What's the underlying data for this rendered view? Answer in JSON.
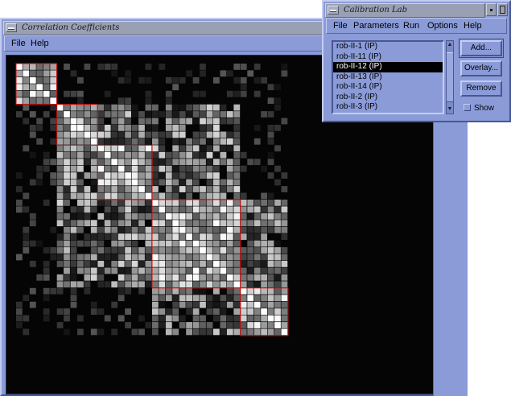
{
  "correlation_window": {
    "title": "Correlation Coefficients",
    "menu": [
      "File",
      "Help"
    ],
    "matrix_cells": 40
  },
  "calibration_window": {
    "title": "Calibration Lab",
    "menu": [
      "File",
      "Parameters",
      "Run",
      "Options",
      "Help"
    ],
    "runs": [
      "rob-II-1 (IP)",
      "rob-II-11 (IP)",
      "rob-II-12 (IP)",
      "rob-II-13 (IP)",
      "rob-II-14 (IP)",
      "rob-II-2 (IP)",
      "rob-II-3 (IP)"
    ],
    "selected_run": "rob-II-12 (IP)",
    "buttons": {
      "add": "Add...",
      "overlay": "Overlay...",
      "remove": "Remove"
    },
    "show_label": "Show",
    "show_checked": false
  },
  "colors": {
    "window_bg": "#8a9bd8",
    "matrix_bg": "#050505",
    "block_outline": "#e01010"
  },
  "icons": [
    "window-menu-icon",
    "minimize-icon",
    "maximize-icon"
  ]
}
